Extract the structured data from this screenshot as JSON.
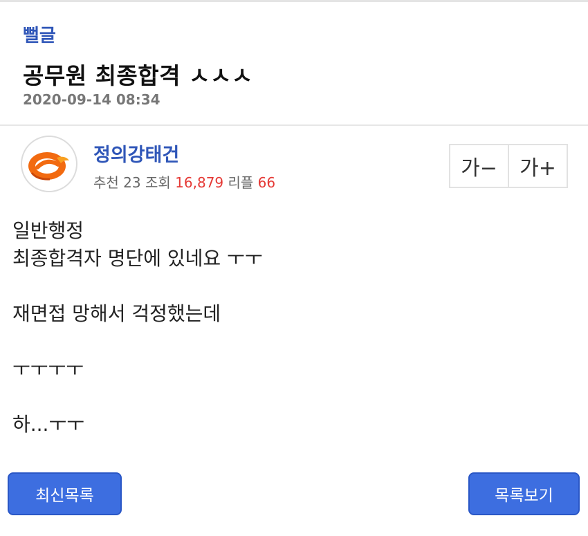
{
  "post": {
    "board": "뻘글",
    "title": "공무원 최종합격 ㅅㅅㅅ",
    "date": "2020-09-14 08:34"
  },
  "author": {
    "name": "정의강태건",
    "avatar_icon": "orange-e-logo-icon"
  },
  "stats": {
    "recommend_label": "추천",
    "recommend_value": "23",
    "views_label": "조회",
    "views_value": "16,879",
    "replies_label": "리플",
    "replies_value": "66",
    "highlight_color": "#e53935"
  },
  "font_controls": {
    "decrease": "가−",
    "increase": "가+"
  },
  "content": {
    "lines": [
      "일반행정",
      "최종합격자 명단에 있네요 ㅜㅜ",
      "",
      "재면접 망해서 걱정했는데",
      "",
      "ㅜㅜㅜㅜ",
      "",
      "하...ㅜㅜ"
    ]
  },
  "buttons": {
    "latest": "최신목록",
    "list": "목록보기",
    "color": "#3d6ee0"
  }
}
